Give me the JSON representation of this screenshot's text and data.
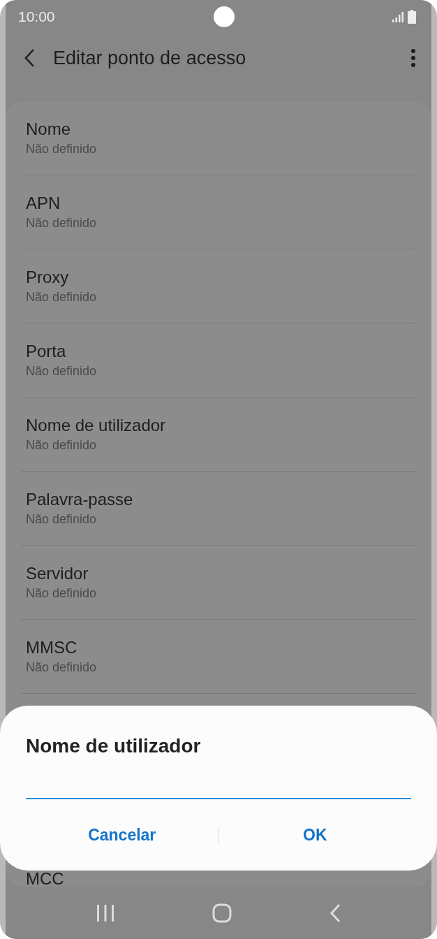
{
  "status_bar": {
    "time": "10:00"
  },
  "app_bar": {
    "title": "Editar ponto de acesso"
  },
  "settings": [
    {
      "title": "Nome",
      "value": "Não definido"
    },
    {
      "title": "APN",
      "value": "Não definido"
    },
    {
      "title": "Proxy",
      "value": "Não definido"
    },
    {
      "title": "Porta",
      "value": "Não definido"
    },
    {
      "title": "Nome de utilizador",
      "value": "Não definido"
    },
    {
      "title": "Palavra-passe",
      "value": "Não definido"
    },
    {
      "title": "Servidor",
      "value": "Não definido"
    },
    {
      "title": "MMSC",
      "value": "Não definido"
    },
    {
      "title": "MCC"
    }
  ],
  "dialog": {
    "title": "Nome de utilizador",
    "input": {
      "focused": true
    },
    "buttons": [
      "Cancelar",
      "OK"
    ]
  }
}
